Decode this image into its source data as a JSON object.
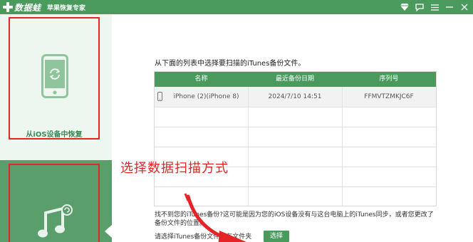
{
  "titlebar": {
    "logo_text": "数据蛙",
    "app_subtitle": "苹果恢复专家",
    "icons": [
      "diamond-icon",
      "chat-icon",
      "menu-icon",
      "minimize-icon",
      "close-icon"
    ]
  },
  "sidebar": {
    "items": [
      {
        "label": "从iOS设备中恢复",
        "icon": "phone-refresh-icon"
      },
      {
        "label": "",
        "icon": "music-refresh-icon"
      }
    ]
  },
  "main": {
    "instruction": "从下面的列表中选择要扫描的iTunes备份文件。",
    "table": {
      "headers": [
        "名称",
        "最近备份日期",
        "序列号"
      ],
      "rows": [
        {
          "name": "iPhone (2)(iPhone 8)",
          "date": "2024/7/10 14:51",
          "serial": "FFMVTZMKJC6F"
        }
      ]
    },
    "annotation": "选择数据扫描方式",
    "note": "找不到您的iTunes备份?这可能是因为您的iOS设备没有与这台电脑上的iTunes同步，或者您更改了备份文件的位置。",
    "select_prompt": "请选择iTunes备份文件所在文件夹",
    "select_button": "选择"
  },
  "colors": {
    "brand_green": "#4a9a5e",
    "annotation_red": "#e52525"
  }
}
